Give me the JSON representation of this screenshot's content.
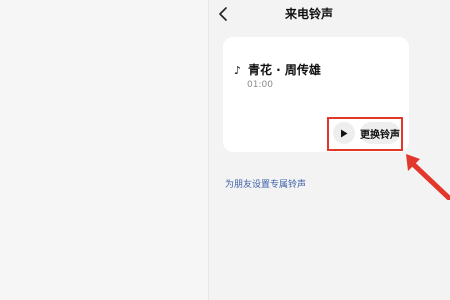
{
  "header": {
    "title": "来电铃声",
    "back_icon": "chevron-left-icon"
  },
  "card": {
    "note_icon": "♪",
    "song_title": "青花 · 周传雄",
    "duration": "01:00",
    "play_icon": "play-icon",
    "change_label": "更换铃声"
  },
  "links": {
    "friend_ringtone": "为朋友设置专属铃声"
  },
  "colors": {
    "highlight": "#e2372b",
    "link": "#3c5fa6"
  }
}
